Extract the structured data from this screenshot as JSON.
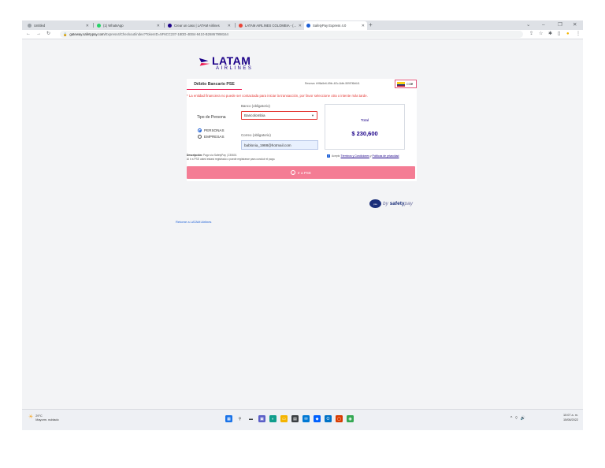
{
  "browser": {
    "tabs": [
      {
        "title": "Untitled",
        "icon_color": "#9aa0a6"
      },
      {
        "title": "(1) WhatsApp",
        "icon_color": "#25d366"
      },
      {
        "title": "Crear un caso | LATAM Airlines",
        "icon_color": "#1b0088"
      },
      {
        "title": "LATAM AIRLINES COLOMBIA - (...",
        "icon_color": "#ea4335"
      },
      {
        "title": "SafetyPay Express 4.0",
        "icon_color": "#1b5ed6"
      }
    ],
    "active_tab_index": 4,
    "url_host": "gateway.safetypay.com",
    "url_path": "/Express4/Checkout/index?TokenID=5F6CC237-18DD-4EB4-9410-B26867998164",
    "window_controls": [
      "⌄",
      "–",
      "❐",
      "✕"
    ]
  },
  "page": {
    "brand_name": "LATAM",
    "brand_sub": "AIRLINES",
    "tab_label": "Débito Bancario PSE",
    "reference": "Reserva: b9f6a5e6-69fe-4f2c-8dfe-559f7f6b641",
    "language": "COL",
    "error_message": "* La entidad financiera no puede ser contactada para iniciar la transacción, por favor seleccione otra o intente más tarde.",
    "bank_label": "Banco (obligatorio)",
    "bank_value": "Bancolombia",
    "person_type_label": "Tipo de Persona",
    "person_options": [
      "PERSONAS",
      "EMPRESAS"
    ],
    "selected_person": "PERSONAS",
    "email_label": "Correo (obligatorio)",
    "email_value": "bablonia_1988@hotmail.com",
    "total_label": "Total",
    "total_value": "$ 230,600",
    "description_title": "Descripción:",
    "description_text": "Pago vía SafetyPay | 230601",
    "description_note": "Al ir a PSE usted estará registrado o puede registrarse para concluir el pago.",
    "accept_prefix": "Acepto",
    "terms_link": "Términos y Condiciones",
    "and_text": "y",
    "privacy_link": "Políticas de privacidad",
    "pse_button": "Ir a PSE",
    "safety_badge": "pse",
    "safety_by": "by",
    "safety_brand": "safety",
    "safety_suffix": "pay",
    "return_link": "Retorne a LATAM Airlines"
  },
  "taskbar": {
    "temperature": "29°C",
    "weather": "Mayorm. nublado",
    "apps": [
      {
        "name": "windows",
        "color": "#1a73e8"
      },
      {
        "name": "search",
        "color": "#3c4043"
      },
      {
        "name": "task-view",
        "color": "#3c4043"
      },
      {
        "name": "chat",
        "color": "#5b5fc7"
      },
      {
        "name": "edge",
        "color": "#0f9d8c"
      },
      {
        "name": "explorer",
        "color": "#f4b400"
      },
      {
        "name": "store",
        "color": "#3c4043"
      },
      {
        "name": "mail",
        "color": "#0078d4"
      },
      {
        "name": "dropbox",
        "color": "#0061fe"
      },
      {
        "name": "outlook",
        "color": "#0072c6"
      },
      {
        "name": "office",
        "color": "#d83b01"
      },
      {
        "name": "chrome",
        "color": "#34a853"
      }
    ],
    "time": "10:07 a. m.",
    "date": "15/08/2022"
  },
  "colors": {
    "brand": "#1b0088",
    "accent": "#ed1650",
    "button": "#f47c94",
    "error": "#e53935"
  }
}
